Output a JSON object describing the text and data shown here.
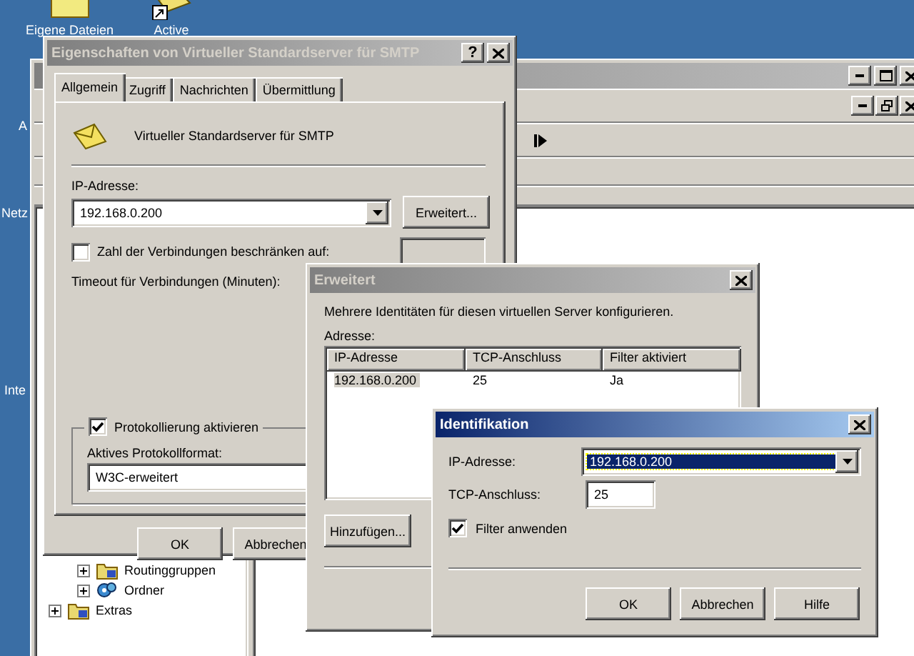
{
  "desktop_icons": [
    {
      "label": "Eigene Dateien",
      "kind": "folder"
    },
    {
      "label": "Active",
      "kind": "shortcut"
    }
  ],
  "desktop_side_labels": [
    "A",
    "Netz",
    "Inte"
  ],
  "console": {
    "active": false,
    "tree": [
      {
        "children": [
          {
            "label": "Routinggruppen",
            "expanded": false
          },
          {
            "label": "Ordner",
            "expanded": false
          }
        ]
      },
      {
        "label": "Extras",
        "expanded": false
      }
    ]
  },
  "properties_dialog": {
    "title": "Eigenschaften von Virtueller Standardserver für SMTP",
    "active": false,
    "help_button": "?",
    "tabs": [
      {
        "label": "Allgemein",
        "selected": true
      },
      {
        "label": "Zugriff",
        "selected": false
      },
      {
        "label": "Nachrichten",
        "selected": false
      },
      {
        "label": "Übermittlung",
        "selected": false
      }
    ],
    "server_name": "Virtueller Standardserver für SMTP",
    "ip_label": "IP-Adresse:",
    "ip_value": "192.168.0.200",
    "advanced_button": "Erweitert...",
    "limit_connections": {
      "label": "Zahl der Verbindungen beschränken auf:",
      "checked": false
    },
    "timeout_label": "Timeout für Verbindungen (Minuten):",
    "logging": {
      "label": "Protokollierung aktivieren",
      "checked": true,
      "format_label": "Aktives Protokollformat:",
      "format_value": "W3C-erweitert"
    },
    "buttons": [
      "OK",
      "Abbrechen"
    ]
  },
  "advanced_dialog": {
    "title": "Erweitert",
    "active": false,
    "description": "Mehrere Identitäten für diesen virtuellen Server konfigurieren.",
    "list_label": "Adresse:",
    "columns": [
      "IP-Adresse",
      "TCP-Anschluss",
      "Filter aktiviert"
    ],
    "rows": [
      {
        "cells": [
          "192.168.0.200",
          "25",
          "Ja"
        ],
        "selected": true
      }
    ],
    "buttons": [
      "Hinzufügen..."
    ]
  },
  "identification_dialog": {
    "title": "Identifikation",
    "active": true,
    "ip_label": "IP-Adresse:",
    "ip_value": "192.168.0.200",
    "ip_highlighted": true,
    "port_label": "TCP-Anschluss:",
    "port_value": "25",
    "filter": {
      "label": "Filter anwenden",
      "checked": true
    },
    "buttons": [
      "OK",
      "Abbrechen",
      "Hilfe"
    ]
  }
}
